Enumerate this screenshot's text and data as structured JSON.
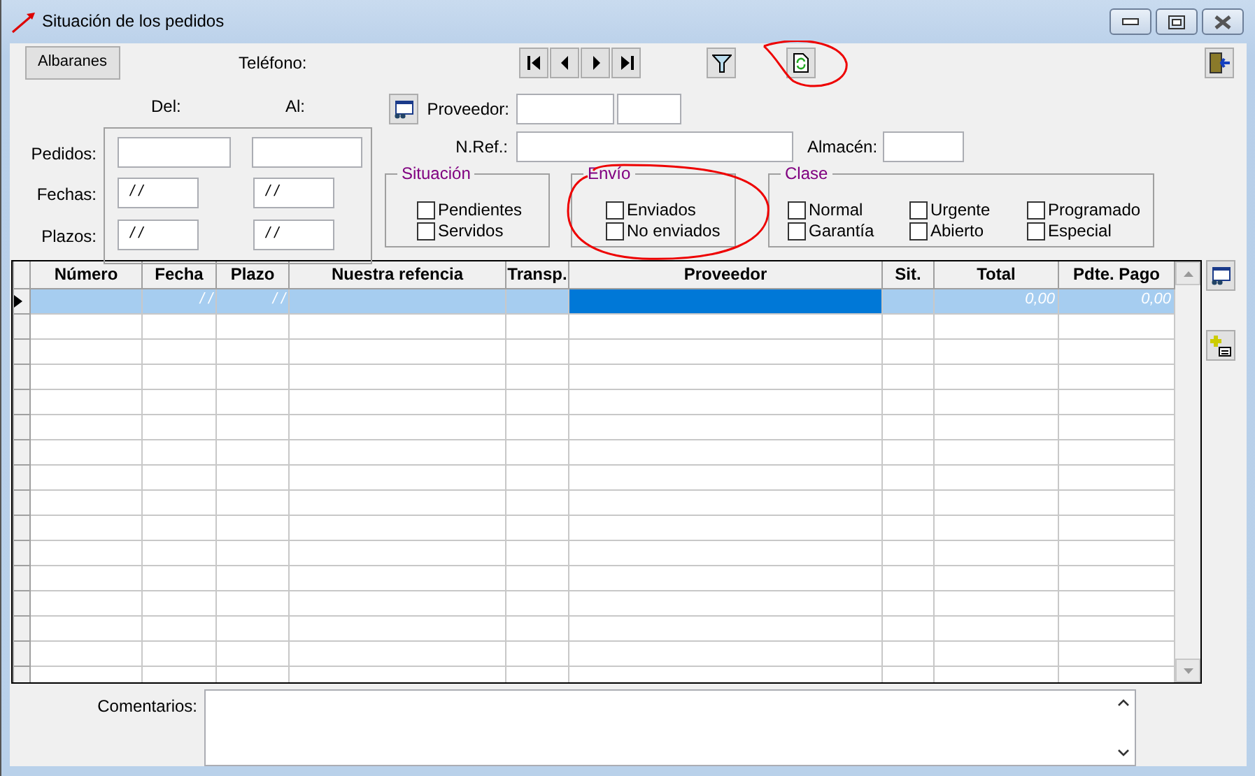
{
  "window": {
    "title": "Situación de los pedidos"
  },
  "toolbar": {
    "albaranes_button": "Albaranes",
    "telefono_label": "Teléfono:"
  },
  "range": {
    "del_label": "Del:",
    "al_label": "Al:",
    "rows": [
      {
        "label": "Pedidos:",
        "from": null,
        "to": null,
        "kind": "wide"
      },
      {
        "label": "Fechas:",
        "from": "/ /",
        "to": "/ /",
        "kind": "date"
      },
      {
        "label": "Plazos:",
        "from": "/ /",
        "to": "/ /",
        "kind": "date"
      }
    ]
  },
  "proveedor_label": "Proveedor:",
  "nref_label": "N.Ref.:",
  "almacen_label": "Almacén:",
  "groups": [
    {
      "title": "Situación",
      "columns": [
        [
          {
            "label": "Pendientes",
            "checked": false
          },
          {
            "label": "Servidos",
            "checked": false
          }
        ]
      ]
    },
    {
      "title": "Envío",
      "columns": [
        [
          {
            "label": "Enviados",
            "checked": false
          },
          {
            "label": "No enviados",
            "checked": false
          }
        ]
      ]
    },
    {
      "title": "Clase",
      "columns": [
        [
          {
            "label": "Normal",
            "checked": false
          },
          {
            "label": "Garantía",
            "checked": false
          }
        ],
        [
          {
            "label": "Urgente",
            "checked": false
          },
          {
            "label": "Abierto",
            "checked": false
          }
        ],
        [
          {
            "label": "Programado",
            "checked": false
          },
          {
            "label": "Especial",
            "checked": false
          }
        ]
      ]
    }
  ],
  "table": {
    "columns": [
      "Número",
      "Fecha",
      "Plazo",
      "Nuestra refencia",
      "Transp.",
      "Proveedor",
      "Sit.",
      "Total",
      "Pdte. Pago"
    ],
    "rows": [
      {
        "selected": true,
        "cells": [
          {
            "focused": false
          },
          {
            "text": "/ /",
            "focused": false
          },
          {
            "text": "/ /",
            "focused": false
          },
          {
            "focused": false
          },
          {
            "focused": false
          },
          {
            "focused": true
          },
          {
            "focused": false
          },
          {
            "text": "0,00",
            "focused": false
          },
          {
            "text": "0,00",
            "focused": false
          }
        ]
      }
    ]
  },
  "comentarios_label": "Comentarios:"
}
